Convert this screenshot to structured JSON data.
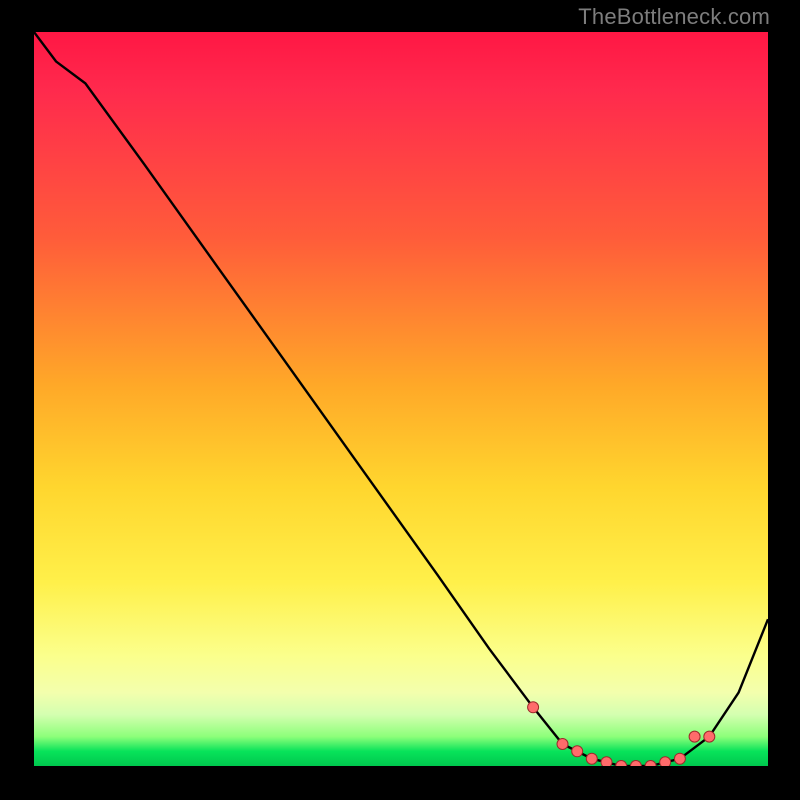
{
  "watermark": "TheBottleneck.com",
  "colors": {
    "frame": "#000000",
    "curve": "#000000",
    "marker_fill": "#ff6b6b",
    "marker_stroke": "#9c2b2b",
    "gradient_top": "#ff1744",
    "gradient_bottom": "#00c74e"
  },
  "chart_data": {
    "type": "line",
    "title": "",
    "xlabel": "",
    "ylabel": "",
    "xlim": [
      0,
      100
    ],
    "ylim": [
      0,
      100
    ],
    "grid": false,
    "series": [
      {
        "name": "bottleneck-curve",
        "x": [
          0,
          3,
          7,
          15,
          25,
          35,
          45,
          55,
          62,
          68,
          72,
          76,
          80,
          84,
          88,
          92,
          96,
          100
        ],
        "y": [
          100,
          96,
          93,
          82,
          68,
          54,
          40,
          26,
          16,
          8,
          3,
          1,
          0,
          0,
          1,
          4,
          10,
          20
        ]
      }
    ],
    "markers": {
      "name": "highlighted-points",
      "x": [
        68,
        72,
        74,
        76,
        78,
        80,
        82,
        84,
        86,
        88,
        90,
        92
      ],
      "y": [
        8,
        3,
        2,
        1,
        0.5,
        0,
        0,
        0,
        0.5,
        1,
        4,
        4
      ]
    }
  }
}
